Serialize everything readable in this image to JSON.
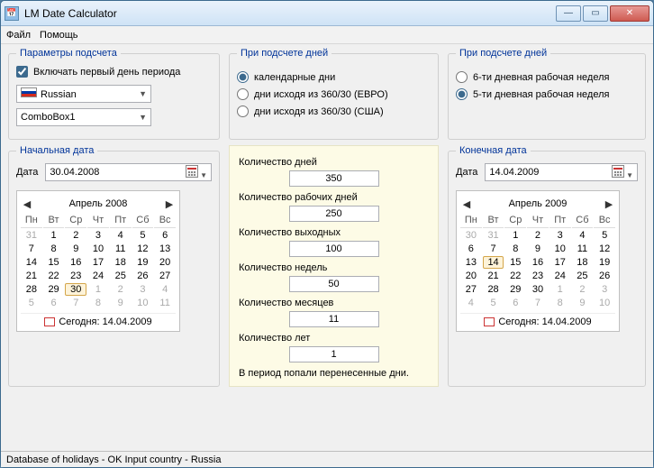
{
  "window": {
    "title": "LM Date Calculator"
  },
  "menu": {
    "file": "Файл",
    "help": "Помощь"
  },
  "params": {
    "legend": "Параметры подсчета",
    "include_first": "Включать первый день периода",
    "include_first_checked": true,
    "lang_value": "Russian",
    "combo2_value": "ComboBox1"
  },
  "count_type": {
    "legend": "При подсчете дней",
    "opt_calendar": "календарные дни",
    "opt_360_euro": "дни исходя из 360/30 (ЕВРО)",
    "opt_360_usa": "дни исходя из 360/30 (США)",
    "selected": "calendar"
  },
  "week_type": {
    "legend": "При подсчете дней",
    "opt_6day": "6-ти дневная рабочая неделя",
    "opt_5day": "5-ти дневная рабочая неделя",
    "selected": "5day"
  },
  "start": {
    "legend": "Начальная дата",
    "label": "Дата",
    "value": "30.04.2008",
    "cal_title": "Апрель 2008",
    "today": "Сегодня: 14.04.2009",
    "dow": [
      "Пн",
      "Вт",
      "Ср",
      "Чт",
      "Пт",
      "Сб",
      "Вс"
    ],
    "cells": [
      {
        "t": "31",
        "o": 1
      },
      {
        "t": "1"
      },
      {
        "t": "2"
      },
      {
        "t": "3"
      },
      {
        "t": "4"
      },
      {
        "t": "5"
      },
      {
        "t": "6"
      },
      {
        "t": "7"
      },
      {
        "t": "8"
      },
      {
        "t": "9"
      },
      {
        "t": "10"
      },
      {
        "t": "11"
      },
      {
        "t": "12"
      },
      {
        "t": "13"
      },
      {
        "t": "14"
      },
      {
        "t": "15"
      },
      {
        "t": "16"
      },
      {
        "t": "17"
      },
      {
        "t": "18"
      },
      {
        "t": "19"
      },
      {
        "t": "20"
      },
      {
        "t": "21"
      },
      {
        "t": "22"
      },
      {
        "t": "23"
      },
      {
        "t": "24"
      },
      {
        "t": "25"
      },
      {
        "t": "26"
      },
      {
        "t": "27"
      },
      {
        "t": "28"
      },
      {
        "t": "29"
      },
      {
        "t": "30",
        "sel": 1
      },
      {
        "t": "1",
        "o": 1
      },
      {
        "t": "2",
        "o": 1
      },
      {
        "t": "3",
        "o": 1
      },
      {
        "t": "4",
        "o": 1
      },
      {
        "t": "5",
        "o": 1
      },
      {
        "t": "6",
        "o": 1
      },
      {
        "t": "7",
        "o": 1
      },
      {
        "t": "8",
        "o": 1
      },
      {
        "t": "9",
        "o": 1
      },
      {
        "t": "10",
        "o": 1
      },
      {
        "t": "11",
        "o": 1
      }
    ]
  },
  "end": {
    "legend": "Конечная дата",
    "label": "Дата",
    "value": "14.04.2009",
    "cal_title": "Апрель 2009",
    "today": "Сегодня: 14.04.2009",
    "dow": [
      "Пн",
      "Вт",
      "Ср",
      "Чт",
      "Пт",
      "Сб",
      "Вс"
    ],
    "cells": [
      {
        "t": "30",
        "o": 1
      },
      {
        "t": "31",
        "o": 1
      },
      {
        "t": "1"
      },
      {
        "t": "2"
      },
      {
        "t": "3"
      },
      {
        "t": "4"
      },
      {
        "t": "5"
      },
      {
        "t": "6"
      },
      {
        "t": "7"
      },
      {
        "t": "8"
      },
      {
        "t": "9"
      },
      {
        "t": "10"
      },
      {
        "t": "11"
      },
      {
        "t": "12"
      },
      {
        "t": "13"
      },
      {
        "t": "14",
        "sel": 1
      },
      {
        "t": "15"
      },
      {
        "t": "16"
      },
      {
        "t": "17"
      },
      {
        "t": "18"
      },
      {
        "t": "19"
      },
      {
        "t": "20"
      },
      {
        "t": "21"
      },
      {
        "t": "22"
      },
      {
        "t": "23"
      },
      {
        "t": "24"
      },
      {
        "t": "25"
      },
      {
        "t": "26"
      },
      {
        "t": "27"
      },
      {
        "t": "28"
      },
      {
        "t": "29"
      },
      {
        "t": "30"
      },
      {
        "t": "1",
        "o": 1
      },
      {
        "t": "2",
        "o": 1
      },
      {
        "t": "3",
        "o": 1
      },
      {
        "t": "4",
        "o": 1
      },
      {
        "t": "5",
        "o": 1
      },
      {
        "t": "6",
        "o": 1
      },
      {
        "t": "7",
        "o": 1
      },
      {
        "t": "8",
        "o": 1
      },
      {
        "t": "9",
        "o": 1
      },
      {
        "t": "10",
        "o": 1
      }
    ]
  },
  "results": {
    "days_label": "Количество дней",
    "days_value": "350",
    "workdays_label": "Количество рабочих дней",
    "workdays_value": "250",
    "holidays_label": "Количество выходных",
    "holidays_value": "100",
    "weeks_label": "Количество недель",
    "weeks_value": "50",
    "months_label": "Количество месяцев",
    "months_value": "11",
    "years_label": "Количество лет",
    "years_value": "1",
    "note": "В период попали перенесенные дни."
  },
  "status": "Database of holidays - OK Input country - Russia"
}
